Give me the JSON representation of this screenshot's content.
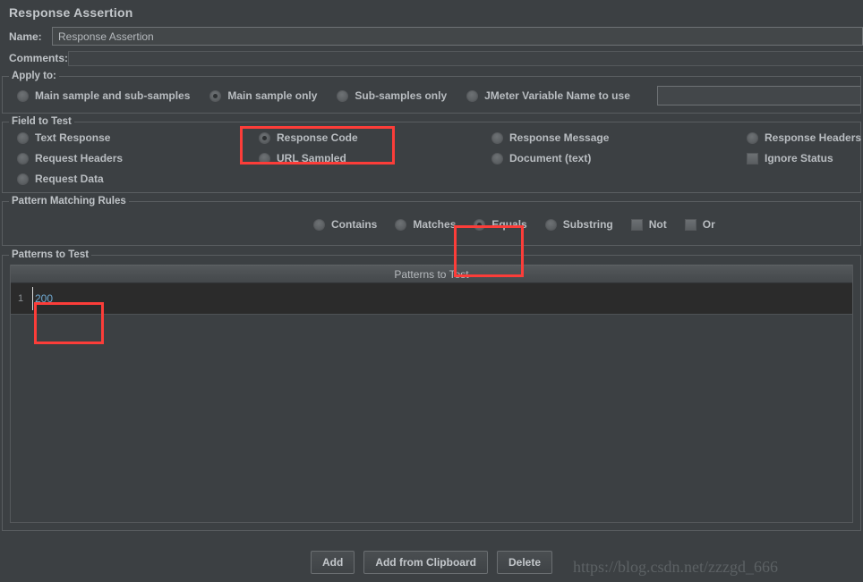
{
  "window": {
    "title": "Response Assertion"
  },
  "name_row": {
    "label": "Name:",
    "value": "Response Assertion"
  },
  "comments_row": {
    "label": "Comments:",
    "value": ""
  },
  "apply_to": {
    "title": "Apply to:",
    "options": [
      {
        "label": "Main sample and sub-samples",
        "selected": false
      },
      {
        "label": "Main sample only",
        "selected": true
      },
      {
        "label": "Sub-samples only",
        "selected": false
      },
      {
        "label": "JMeter Variable Name to use",
        "selected": false
      }
    ],
    "variable_value": ""
  },
  "field_to_test": {
    "title": "Field to Test",
    "options": [
      {
        "label": "Text Response",
        "selected": false,
        "type": "radio"
      },
      {
        "label": "Response Code",
        "selected": true,
        "type": "radio"
      },
      {
        "label": "Response Message",
        "selected": false,
        "type": "radio"
      },
      {
        "label": "Response Headers",
        "selected": false,
        "type": "radio"
      },
      {
        "label": "Request Headers",
        "selected": false,
        "type": "radio"
      },
      {
        "label": "URL Sampled",
        "selected": false,
        "type": "radio"
      },
      {
        "label": "Document (text)",
        "selected": false,
        "type": "radio"
      },
      {
        "label": "Ignore Status",
        "selected": false,
        "type": "checkbox"
      },
      {
        "label": "Request Data",
        "selected": false,
        "type": "radio"
      }
    ]
  },
  "pattern_matching_rules": {
    "title": "Pattern Matching Rules",
    "options": [
      {
        "label": "Contains",
        "selected": false,
        "type": "radio"
      },
      {
        "label": "Matches",
        "selected": false,
        "type": "radio"
      },
      {
        "label": "Equals",
        "selected": true,
        "type": "radio"
      },
      {
        "label": "Substring",
        "selected": false,
        "type": "radio"
      },
      {
        "label": "Not",
        "selected": false,
        "type": "checkbox"
      },
      {
        "label": "Or",
        "selected": false,
        "type": "checkbox"
      }
    ]
  },
  "patterns_to_test": {
    "title": "Patterns to Test",
    "column_header": "Patterns to Test",
    "rows": [
      {
        "index": "1",
        "value": "200"
      }
    ]
  },
  "buttons": [
    {
      "label": "Add"
    },
    {
      "label": "Add from Clipboard"
    },
    {
      "label": "Delete"
    }
  ],
  "watermark": {
    "text": "https://blog.csdn.net/zzzgd_666"
  },
  "annotations": {
    "accent_color": "#fc3d39",
    "boxes": [
      "response-code",
      "equals",
      "pattern-200"
    ]
  }
}
